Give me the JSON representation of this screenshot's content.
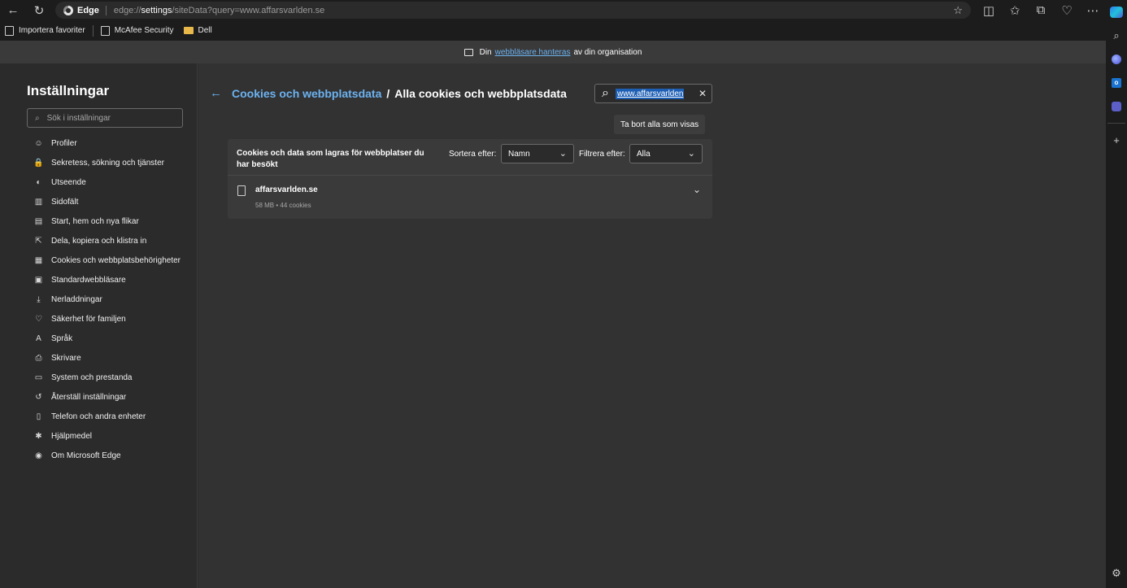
{
  "browser": {
    "app_name": "Edge",
    "url_prefix": "edge://",
    "url_bold": "settings",
    "url_rest": "/siteData?query=www.affarsvarlden.se"
  },
  "bookmarks": [
    {
      "label": "Importera favoriter"
    },
    {
      "label": "McAfee Security"
    },
    {
      "label": "Dell"
    }
  ],
  "banner": {
    "before": "Din",
    "link": "webbläsare hanteras",
    "after": "av din organisation"
  },
  "settings": {
    "title": "Inställningar",
    "search_placeholder": "Sök i inställningar",
    "nav": [
      {
        "label": "Profiler",
        "icon": "profile-icon",
        "glyph": "☺"
      },
      {
        "label": "Sekretess, sökning och tjänster",
        "icon": "lock-icon",
        "glyph": "🔒"
      },
      {
        "label": "Utseende",
        "icon": "appearance-icon",
        "glyph": "◐"
      },
      {
        "label": "Sidofält",
        "icon": "sidebar-icon",
        "glyph": "▥"
      },
      {
        "label": "Start, hem och nya flikar",
        "icon": "home-tabs-icon",
        "glyph": "▤"
      },
      {
        "label": "Dela, kopiera och klistra in",
        "icon": "share-icon",
        "glyph": "⇱"
      },
      {
        "label": "Cookies och webbplatsbehörigheter",
        "icon": "cookies-permissions-icon",
        "glyph": "▦"
      },
      {
        "label": "Standardwebbläsare",
        "icon": "default-browser-icon",
        "glyph": "▣"
      },
      {
        "label": "Nerladdningar",
        "icon": "download-icon",
        "glyph": "⤓"
      },
      {
        "label": "Säkerhet för familjen",
        "icon": "family-icon",
        "glyph": "♡"
      },
      {
        "label": "Språk",
        "icon": "language-icon",
        "glyph": "A"
      },
      {
        "label": "Skrivare",
        "icon": "printer-icon",
        "glyph": "⎙"
      },
      {
        "label": "System och prestanda",
        "icon": "system-icon",
        "glyph": "▭"
      },
      {
        "label": "Återställ inställningar",
        "icon": "reset-icon",
        "glyph": "↺"
      },
      {
        "label": "Telefon och andra enheter",
        "icon": "phone-icon",
        "glyph": "▯"
      },
      {
        "label": "Hjälpmedel",
        "icon": "accessibility-icon",
        "glyph": "✱"
      },
      {
        "label": "Om Microsoft Edge",
        "icon": "edge-about-icon",
        "glyph": "◉"
      }
    ]
  },
  "page": {
    "breadcrumb_link": "Cookies och webbplatsdata",
    "breadcrumb_sep": "/",
    "breadcrumb_current": "Alla cookies och webbplatsdata",
    "search_value": "www.affarsvarlden",
    "remove_all_label": "Ta bort alla som visas",
    "card_heading": "Cookies och data som lagras för webbplatser du har besökt",
    "sort_label": "Sortera efter:",
    "sort_value": "Namn",
    "filter_label": "Filtrera efter:",
    "filter_value": "Alla",
    "sites": [
      {
        "name": "affarsvarlden.se",
        "meta": "58 MB • 44 cookies"
      }
    ]
  },
  "colors": {
    "accent": "#6cb2f0",
    "background": "#323232",
    "selection": "#1d5fb4"
  }
}
